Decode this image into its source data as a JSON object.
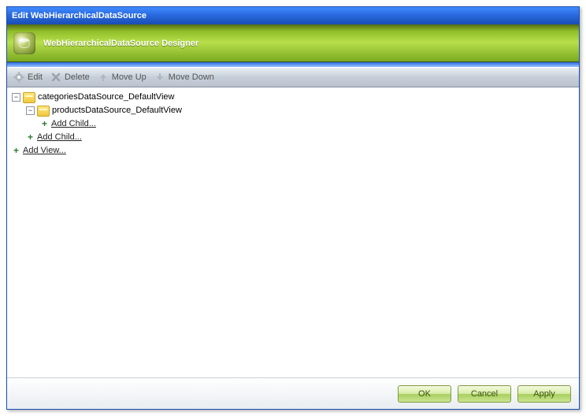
{
  "title": "Edit WebHierarchicalDataSource",
  "banner": {
    "title": "WebHierarchicalDataSource Designer"
  },
  "toolbar": {
    "edit": "Edit",
    "delete": "Delete",
    "moveUp": "Move Up",
    "moveDown": "Move Down"
  },
  "tree": {
    "root": {
      "label": "categoriesDataSource_DefaultView",
      "child": {
        "label": "productsDataSource_DefaultView",
        "addChild": "Add Child..."
      },
      "addChild": "Add Child..."
    },
    "addView": "Add View..."
  },
  "footer": {
    "ok": "OK",
    "cancel": "Cancel",
    "apply": "Apply"
  }
}
